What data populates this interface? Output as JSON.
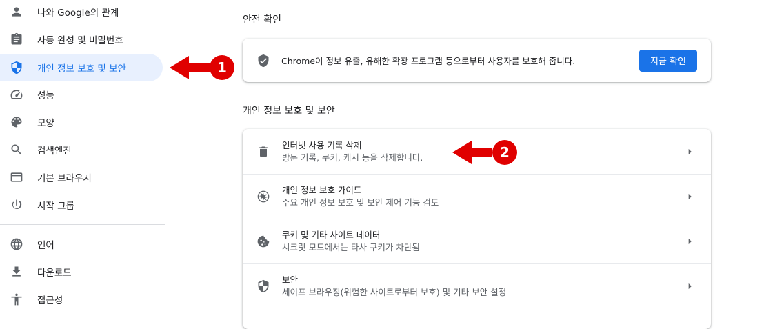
{
  "sidebar": {
    "items": [
      {
        "label": "나와 Google의 관계",
        "icon": "person-icon"
      },
      {
        "label": "자동 완성 및 비밀번호",
        "icon": "clipboard-icon"
      },
      {
        "label": "개인 정보 보호 및 보안",
        "icon": "shield-icon",
        "active": true
      },
      {
        "label": "성능",
        "icon": "speedometer-icon"
      },
      {
        "label": "모양",
        "icon": "palette-icon"
      },
      {
        "label": "검색엔진",
        "icon": "search-icon"
      },
      {
        "label": "기본 브라우저",
        "icon": "browser-window-icon"
      },
      {
        "label": "시작 그룹",
        "icon": "power-icon"
      },
      {
        "label": "언어",
        "icon": "globe-icon"
      },
      {
        "label": "다운로드",
        "icon": "download-icon"
      },
      {
        "label": "접근성",
        "icon": "accessibility-icon"
      }
    ]
  },
  "safety_check": {
    "title": "안전 확인",
    "description": "Chrome이 정보 유출, 유해한 확장 프로그램 등으로부터 사용자를 보호해 줍니다.",
    "button": "지금 확인"
  },
  "privacy": {
    "title": "개인 정보 보호 및 보안",
    "rows": [
      {
        "title": "인터넷 사용 기록 삭제",
        "subtitle": "방문 기록, 쿠키, 캐시 등을 삭제합니다.",
        "icon": "trash-icon"
      },
      {
        "title": "개인 정보 보호 가이드",
        "subtitle": "주요 개인 정보 보호 및 보안 제어 기능 검토",
        "icon": "compass-icon"
      },
      {
        "title": "쿠키 및 기타 사이트 데이터",
        "subtitle": "시크릿 모드에서는 타사 쿠키가 차단됨",
        "icon": "cookie-icon"
      },
      {
        "title": "보안",
        "subtitle": "세이프 브라우징(위험한 사이트로부터 보호) 및 기타 보안 설정",
        "icon": "security-shield-icon"
      }
    ]
  },
  "annotations": [
    {
      "number": "1",
      "color": "#e00000"
    },
    {
      "number": "2",
      "color": "#e00000"
    }
  ]
}
